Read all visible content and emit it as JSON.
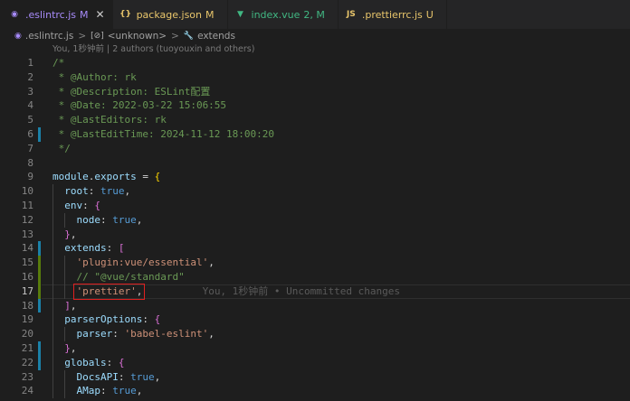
{
  "tabs": [
    {
      "icon": "vue-icon",
      "name": ".eslintrc.js",
      "badge": "M",
      "active": true,
      "close": "✕",
      "color": "#a78bfa"
    },
    {
      "icon": "json-icon",
      "name": "package.json",
      "badge": "M",
      "active": false,
      "color": "#e8c56b"
    },
    {
      "icon": "vue-file-icon",
      "name": "index.vue",
      "badge": "2, M",
      "active": false,
      "color": "#41b883"
    },
    {
      "icon": "js-icon",
      "name": ".prettierrc.js",
      "badge": "U",
      "active": false,
      "color": "#e8c56b"
    }
  ],
  "breadcrumb": [
    ".eslintrc.js",
    "<unknown>",
    "extends"
  ],
  "blame": "You, 1秒钟前 | 2 authors (tuoyouxin and others)",
  "ghost_blame": "You, 1秒钟前 • Uncommitted changes",
  "lines": [
    {
      "n": "1",
      "segs": [
        [
          "c",
          "/*"
        ]
      ]
    },
    {
      "n": "2",
      "segs": [
        [
          "c",
          " * @Author: rk"
        ]
      ]
    },
    {
      "n": "3",
      "segs": [
        [
          "c",
          " * @Description: ESLint配置"
        ]
      ]
    },
    {
      "n": "4",
      "segs": [
        [
          "c",
          " * @Date: 2022-03-22 15:06:55"
        ]
      ]
    },
    {
      "n": "5",
      "segs": [
        [
          "c",
          " * @LastEditors: rk"
        ]
      ]
    },
    {
      "n": "6",
      "segs": [
        [
          "c",
          " * @LastEditTime: 2024-11-12 18:00:20"
        ]
      ]
    },
    {
      "n": "7",
      "segs": [
        [
          "c",
          " */"
        ]
      ]
    },
    {
      "n": "8",
      "segs": []
    },
    {
      "n": "9",
      "segs": [
        [
          "v",
          "module"
        ],
        [
          "p",
          "."
        ],
        [
          "v",
          "exports"
        ],
        [
          "p",
          " = "
        ],
        [
          "b1",
          "{"
        ]
      ]
    },
    {
      "n": "10",
      "segs": [
        [
          "v",
          "  root"
        ],
        [
          "p",
          ": "
        ],
        [
          "k",
          "true"
        ],
        [
          "p",
          ","
        ]
      ]
    },
    {
      "n": "11",
      "segs": [
        [
          "v",
          "  env"
        ],
        [
          "p",
          ": "
        ],
        [
          "b2",
          "{"
        ]
      ]
    },
    {
      "n": "12",
      "segs": [
        [
          "v",
          "    node"
        ],
        [
          "p",
          ": "
        ],
        [
          "k",
          "true"
        ],
        [
          "p",
          ","
        ]
      ]
    },
    {
      "n": "13",
      "segs": [
        [
          "b2",
          "  }"
        ],
        [
          "p",
          ","
        ]
      ]
    },
    {
      "n": "14",
      "segs": [
        [
          "v",
          "  extends"
        ],
        [
          "p",
          ": "
        ],
        [
          "b2",
          "["
        ]
      ]
    },
    {
      "n": "15",
      "segs": [
        [
          "s",
          "    'plugin:vue/essential'"
        ],
        [
          "p",
          ","
        ]
      ]
    },
    {
      "n": "16",
      "segs": [
        [
          "c",
          "    // \"@vue/standard\""
        ]
      ]
    },
    {
      "n": "17",
      "segs": [
        [
          "s",
          "    'prettier'"
        ],
        [
          "p",
          ","
        ]
      ]
    },
    {
      "n": "18",
      "segs": [
        [
          "b2",
          "  ]"
        ],
        [
          "p",
          ","
        ]
      ]
    },
    {
      "n": "19",
      "segs": [
        [
          "v",
          "  parserOptions"
        ],
        [
          "p",
          ": "
        ],
        [
          "b2",
          "{"
        ]
      ]
    },
    {
      "n": "20",
      "segs": [
        [
          "v",
          "    parser"
        ],
        [
          "p",
          ": "
        ],
        [
          "s",
          "'babel-eslint'"
        ],
        [
          "p",
          ","
        ]
      ]
    },
    {
      "n": "21",
      "segs": [
        [
          "b2",
          "  }"
        ],
        [
          "p",
          ","
        ]
      ]
    },
    {
      "n": "22",
      "segs": [
        [
          "v",
          "  globals"
        ],
        [
          "p",
          ": "
        ],
        [
          "b2",
          "{"
        ]
      ]
    },
    {
      "n": "23",
      "segs": [
        [
          "v",
          "    DocsAPI"
        ],
        [
          "p",
          ": "
        ],
        [
          "k",
          "true"
        ],
        [
          "p",
          ","
        ]
      ]
    },
    {
      "n": "24",
      "segs": [
        [
          "v",
          "    AMap"
        ],
        [
          "p",
          ": "
        ],
        [
          "k",
          "true"
        ],
        [
          "p",
          ","
        ]
      ]
    }
  ],
  "current_line": "17",
  "colors": {
    "added": "#587c0c",
    "modified": "#1b81a8",
    "highlight": "#e02020"
  }
}
